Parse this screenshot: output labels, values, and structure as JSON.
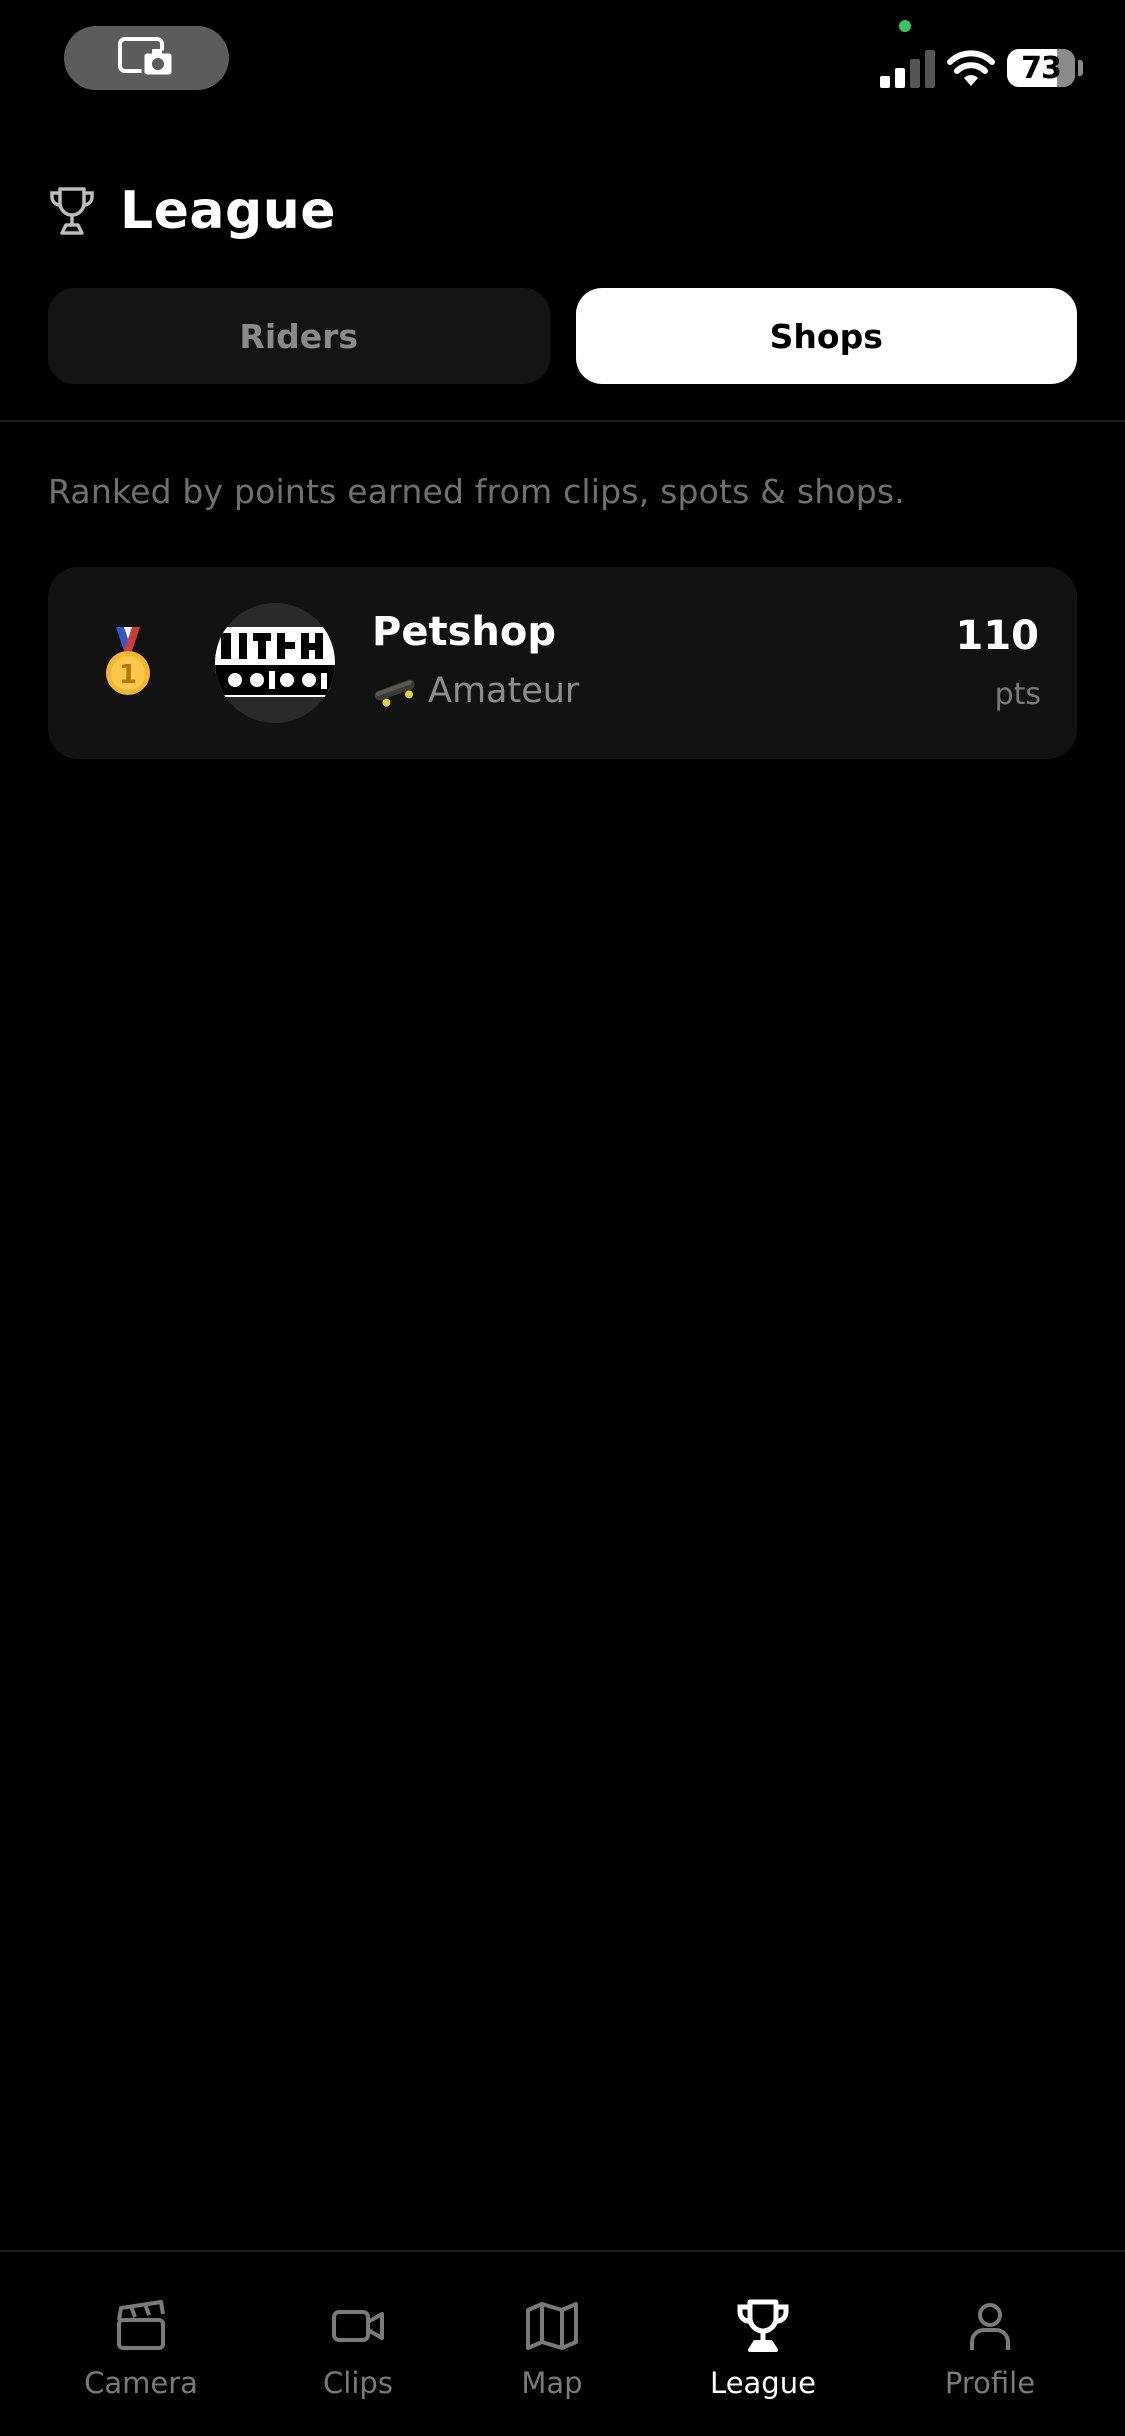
{
  "status_bar": {
    "battery": "73",
    "icons": [
      "screen-record-icon",
      "cellular-signal-icon",
      "wifi-icon",
      "battery-icon"
    ]
  },
  "header": {
    "title": "League",
    "icon": "trophy-icon"
  },
  "tabs": [
    {
      "label": "Riders",
      "active": false
    },
    {
      "label": "Shops",
      "active": true
    }
  ],
  "subtitle": "Ranked by points earned from clips, spots & shops.",
  "leaderboard": [
    {
      "rank_icon": "gold-medal-icon",
      "name": "Petshop",
      "tier": "Amateur",
      "tier_icon": "skateboard-icon",
      "points": "110",
      "points_unit": "pts"
    }
  ],
  "nav": {
    "items": [
      {
        "label": "Camera",
        "icon": "clapperboard-icon",
        "active": false
      },
      {
        "label": "Clips",
        "icon": "video-camera-icon",
        "active": false
      },
      {
        "label": "Map",
        "icon": "map-icon",
        "active": false
      },
      {
        "label": "League",
        "icon": "trophy-icon",
        "active": true
      },
      {
        "label": "Profile",
        "icon": "person-icon",
        "active": false
      }
    ]
  },
  "colors": {
    "background": "#000000",
    "card": "#121212",
    "active_tab": "#ffffff",
    "inactive_text": "#7a7a7a",
    "medal_gold": "#f2b632",
    "recording_dot": "#34c759"
  }
}
